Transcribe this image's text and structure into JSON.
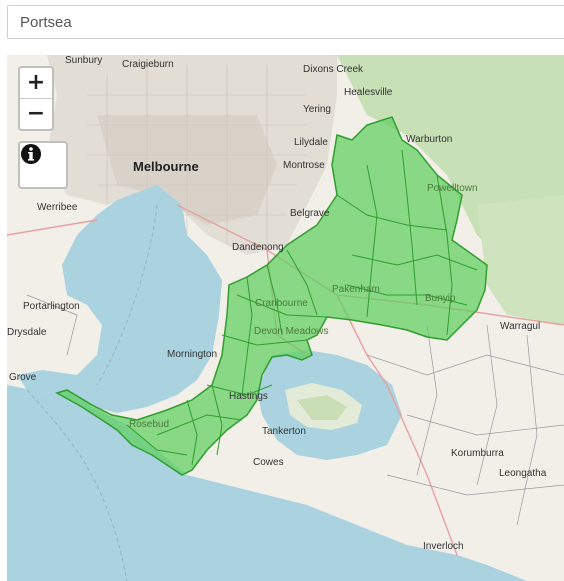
{
  "search": {
    "value": "Portsea"
  },
  "controls": {
    "zoom_in": "+",
    "zoom_out": "−",
    "info_icon": "info-circle"
  },
  "colors": {
    "water": "#aad3df",
    "land": "#f2efe9",
    "urban": "#e0dad2",
    "forest": "#add19e",
    "highlight": "#5fcf5f",
    "highlight_border": "#2f9e2f"
  },
  "places": {
    "sunbury": "Sunbury",
    "craigieburn": "Craigieburn",
    "dixons_creek": "Dixons Creek",
    "healesville": "Healesville",
    "yering": "Yering",
    "lilydale": "Lilydale",
    "warburton": "Warburton",
    "melbourne": "Melbourne",
    "montrose": "Montrose",
    "powelltown": "Powelltown",
    "werribee": "Werribee",
    "belgrave": "Belgrave",
    "dandenong": "Dandenong",
    "pakenham": "Pakenham",
    "cranbourne": "Cranbourne",
    "bunyip": "Bunyip",
    "portarlington": "Portarlington",
    "devon_meadows": "Devon Meadows",
    "warragul": "Warragul",
    "drysdale": "Drysdale",
    "mornington": "Mornington",
    "grove": "Grove",
    "hastings": "Hastings",
    "rosebud": "Rosebud",
    "tankerton": "Tankerton",
    "cowes": "Cowes",
    "korumburra": "Korumburra",
    "leongatha": "Leongatha",
    "inverloch": "Inverloch"
  }
}
